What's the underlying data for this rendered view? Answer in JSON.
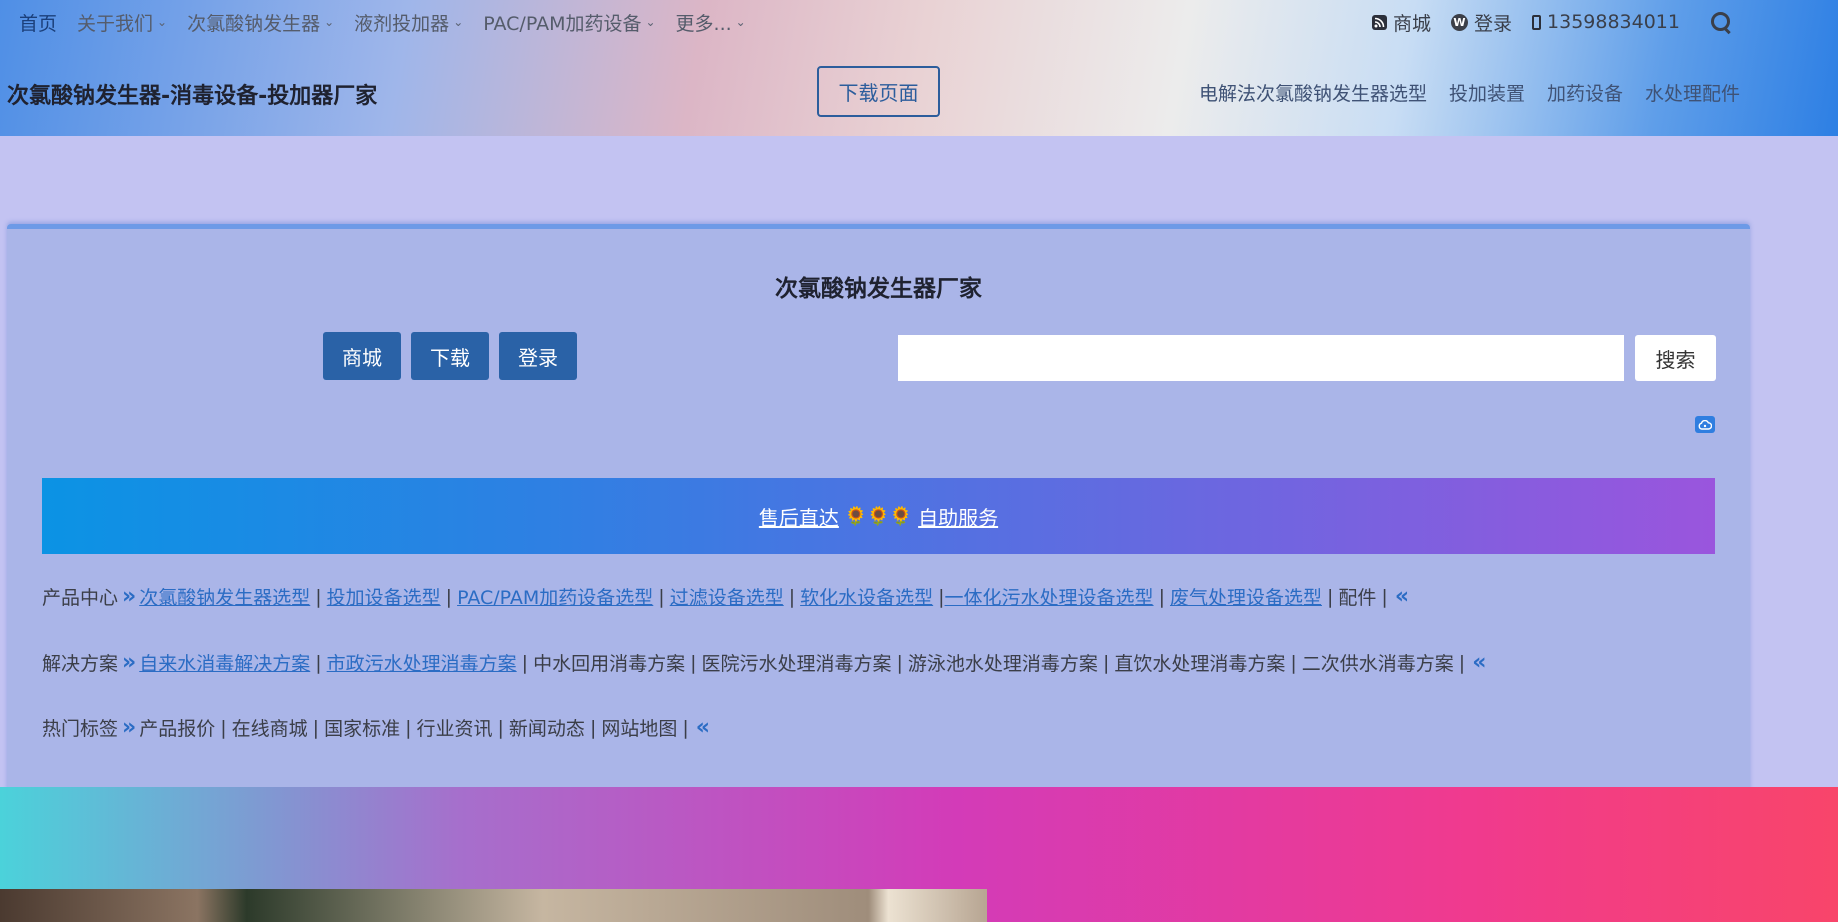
{
  "topnav": {
    "items": [
      {
        "label": "首页",
        "dropdown": false
      },
      {
        "label": "关于我们",
        "dropdown": true
      },
      {
        "label": "次氯酸钠发生器",
        "dropdown": true
      },
      {
        "label": "液剂投加器",
        "dropdown": true
      },
      {
        "label": "PAC/PAM加药设备",
        "dropdown": true
      },
      {
        "label": "更多...",
        "dropdown": true
      }
    ],
    "chevron": "⌄"
  },
  "topright": {
    "mall": "商城",
    "login": "登录",
    "phone": "13598834011",
    "wp_glyph": "W"
  },
  "header": {
    "site_title": "次氯酸钠发生器-消毒设备-投加器厂家",
    "download_page": "下载页面",
    "secondary_nav": [
      "电解法次氯酸钠发生器选型",
      "投加装置",
      "加药设备",
      "水处理配件"
    ]
  },
  "card": {
    "title": "次氯酸钠发生器厂家",
    "buttons": {
      "mall": "商城",
      "download": "下载",
      "login": "登录"
    },
    "search": {
      "value": "",
      "placeholder": "",
      "button": "搜索"
    },
    "banner": {
      "left": "售后直达",
      "flowers": "🌻🌻🌻",
      "right": "自助服务"
    },
    "rows": {
      "products": {
        "label": "产品中心",
        "links": [
          "次氯酸钠发生器选型",
          "投加设备选型",
          "PAC/PAM加药设备选型",
          "过滤设备选型",
          "软化水设备选型",
          "一体化污水处理设备选型",
          "废气处理设备选型"
        ],
        "plain": [
          "配件"
        ]
      },
      "solutions": {
        "label": "解决方案",
        "links": [
          "自来水消毒解决方案",
          "市政污水处理消毒方案"
        ],
        "plain": [
          "中水回用消毒方案",
          "医院污水处理消毒方案",
          "游泳池水处理消毒方案",
          "直饮水处理消毒方案",
          "二次供水消毒方案"
        ]
      },
      "tags": {
        "label": "热门标签",
        "plain": [
          "产品报价",
          "在线商城",
          "国家标准",
          "行业资讯",
          "新闻动态",
          "网站地图"
        ]
      },
      "sep": "|",
      "arrow_right": "»",
      "arrow_left": "«"
    }
  },
  "colors": {
    "primary_button": "#2a62a7",
    "link": "#2b6cc4",
    "card_bg": "#aab5e8",
    "page_bg": "#c3c3f2"
  },
  "icons": [
    "rss-icon",
    "wordpress-icon",
    "phone-icon",
    "search-icon",
    "cloud-icon",
    "chevron-down-icon",
    "double-arrow-right-icon",
    "double-arrow-left-icon"
  ]
}
